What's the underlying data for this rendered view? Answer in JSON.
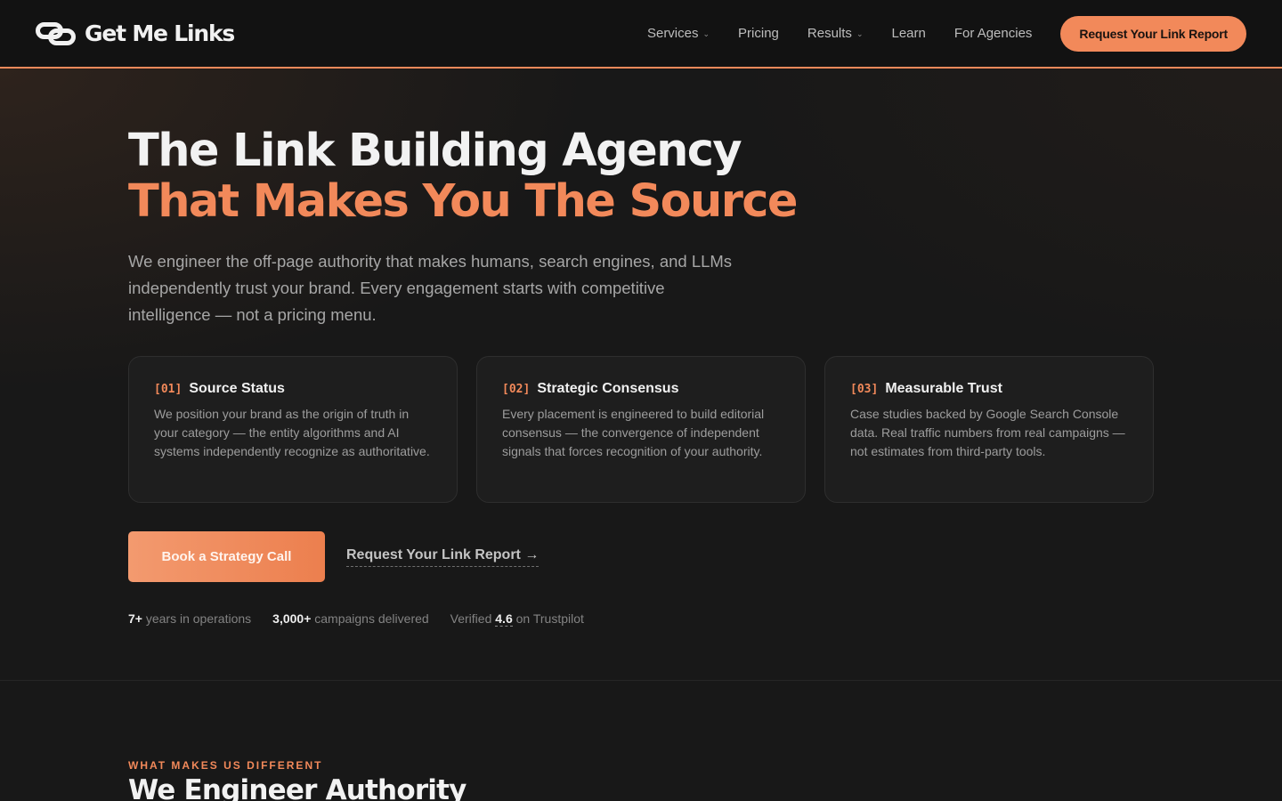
{
  "header": {
    "brand_name": "Get Me Links",
    "nav": [
      {
        "label": "Services",
        "has_dropdown": true
      },
      {
        "label": "Pricing",
        "has_dropdown": false
      },
      {
        "label": "Results",
        "has_dropdown": true
      },
      {
        "label": "Learn",
        "has_dropdown": false
      },
      {
        "label": "For Agencies",
        "has_dropdown": false
      }
    ],
    "cta_label": "Request Your Link Report"
  },
  "hero": {
    "title_line1": "The Link Building Agency",
    "title_line2": "That Makes You The Source",
    "lead": "We engineer the off-page authority that makes humans, search engines, and LLMs independently trust your brand. Every engagement starts with competitive intelligence — not a pricing menu.",
    "cards": [
      {
        "num": "[01]",
        "title": "Source Status",
        "text": "We position your brand as the origin of truth in your category — the entity algorithms and AI systems independently recognize as authoritative."
      },
      {
        "num": "[02]",
        "title": "Strategic Consensus",
        "text": "Every placement is engineered to build editorial consensus — the convergence of independent signals that forces recognition of your authority."
      },
      {
        "num": "[03]",
        "title": "Measurable Trust",
        "text": "Case studies backed by Google Search Console data. Real traffic numbers from real campaigns — not estimates from third-party tools."
      }
    ],
    "primary_cta": "Book a Strategy Call",
    "secondary_cta": "Request Your Link Report →",
    "stats": {
      "years_value": "7+",
      "years_label": "years in operations",
      "campaigns_value": "3,000+",
      "campaigns_label": "campaigns delivered",
      "rating_prefix": "Verified",
      "rating_value": "4.6",
      "rating_suffix": "on Trustpilot"
    }
  },
  "next_section": {
    "eyebrow": "WHAT MAKES US DIFFERENT",
    "title": "We Engineer Authority"
  },
  "colors": {
    "accent": "#f2895a",
    "background": "#181818",
    "header_background": "#121212",
    "card_background": "#1e1e1e"
  },
  "icons": {
    "logo": "chain-link-icon",
    "dropdown": "chevron-down-icon"
  }
}
